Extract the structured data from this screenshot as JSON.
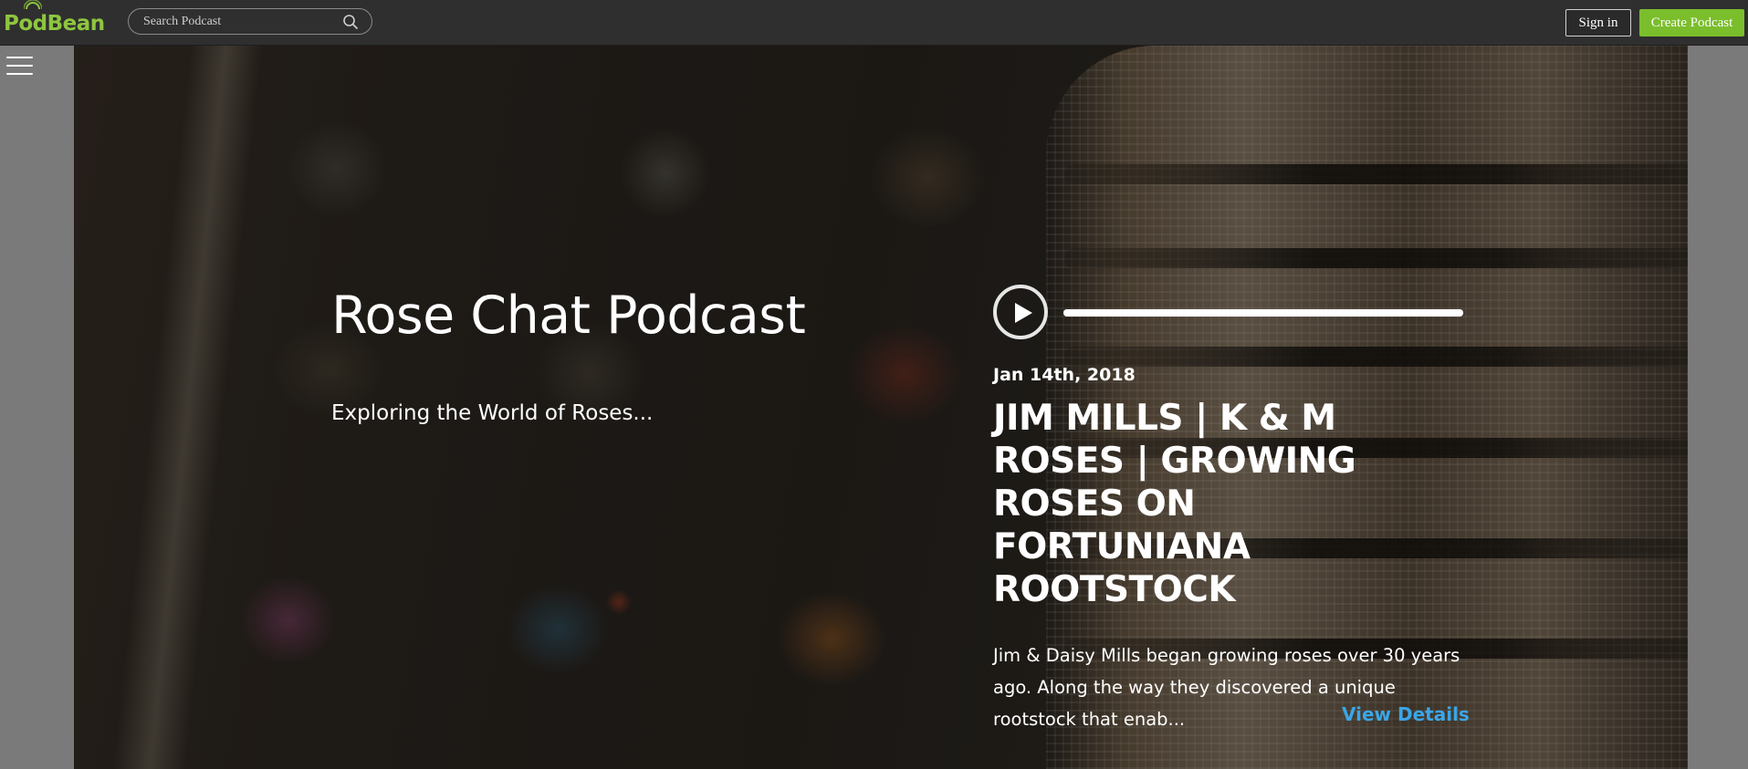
{
  "header": {
    "logo_text": "PodBean",
    "logo_part_1": "P",
    "logo_part_2": "dBean",
    "search_placeholder": "Search Podcast",
    "signin_label": "Sign in",
    "create_label": "Create Podcast",
    "brand_color": "#8dc63f"
  },
  "podcast": {
    "title": "Rose Chat Podcast",
    "subtitle": "Exploring the World of Roses..."
  },
  "episode": {
    "date": "Jan 14th, 2018",
    "title": "JIM MILLS | K & M ROSES | GROWING ROSES ON FORTUNIANA ROOTSTOCK",
    "description": "Jim & Daisy Mills began growing roses over 30 years ago. Along the way they discovered a unique rootstock that enab...",
    "view_details_label": "View Details",
    "link_color": "#3aa6e8"
  },
  "player": {
    "progress": 1.0
  },
  "icons": {
    "menu": "hamburger-menu-icon",
    "search": "search-icon",
    "play": "play-icon"
  }
}
